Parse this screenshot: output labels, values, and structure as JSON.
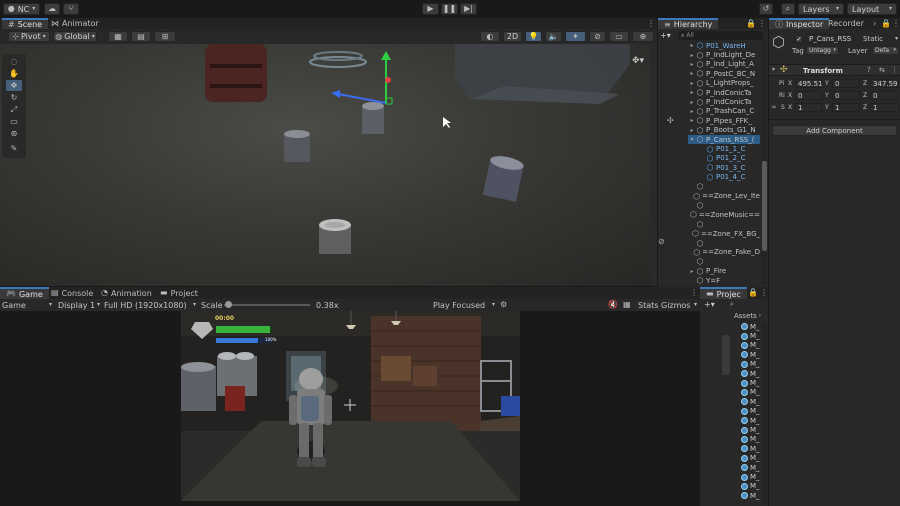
{
  "topbar": {
    "account": "NC",
    "play_icon": "play-icon",
    "pause_icon": "pause-icon",
    "step_icon": "step-icon",
    "layers": "Layers",
    "layout": "Layout"
  },
  "scene": {
    "tabs": [
      {
        "label": "Scene"
      },
      {
        "label": "Animator"
      }
    ],
    "pivot": "Pivot",
    "global": "Global",
    "mode_2d": "2D"
  },
  "game": {
    "tabs": [
      {
        "label": "Game"
      },
      {
        "label": "Console"
      },
      {
        "label": "Animation"
      },
      {
        "label": "Project"
      }
    ],
    "display_type": "Game",
    "display": "Display 1",
    "resolution": "Full HD (1920x1080)",
    "scale_label": "Scale",
    "scale_value": "0.38x",
    "scale_level": 0.02,
    "play_mode": "Play Focused",
    "stats": "Stats",
    "gizmos": "Gizmos",
    "hud_timer": "00:00",
    "hud_pct": "100%"
  },
  "hierarchy": {
    "title": "Hierarchy",
    "search": "All",
    "items": [
      {
        "label": "P01_WareH",
        "blue": true,
        "arrow": "▸"
      },
      {
        "label": "P_IndLight_De",
        "blue": false,
        "arrow": "▸"
      },
      {
        "label": "P_Ind_Light_A",
        "blue": false,
        "arrow": "▸"
      },
      {
        "label": "P_PostC_BC_N",
        "blue": false,
        "arrow": "▸"
      },
      {
        "label": "L_LightProps_",
        "blue": false,
        "arrow": "▸"
      },
      {
        "label": "P_IndConicTa",
        "blue": false,
        "arrow": "▸"
      },
      {
        "label": "P_IndConicTa",
        "blue": false,
        "arrow": "▸"
      },
      {
        "label": "P_TrashCan_C",
        "blue": false,
        "arrow": "▸"
      },
      {
        "label": "P_Pipes_FFK_",
        "blue": false,
        "arrow": "▸"
      },
      {
        "label": "P_Boots_G1_N",
        "blue": false,
        "arrow": "▸"
      },
      {
        "label": "P_Cans_RSS_(",
        "blue": false,
        "arrow": "▾",
        "selected": true
      },
      {
        "label": "P01_1_C",
        "blue": true,
        "arrow": "",
        "indent": true
      },
      {
        "label": "P01_2_C",
        "blue": true,
        "arrow": "",
        "indent": true
      },
      {
        "label": "P01_3_C",
        "blue": true,
        "arrow": "",
        "indent": true
      },
      {
        "label": "P01_4_C",
        "blue": true,
        "arrow": "",
        "indent": true
      },
      {
        "label": "",
        "blue": false,
        "arrow": ""
      },
      {
        "label": "==Zone_Lev_Ite",
        "blue": false,
        "arrow": ""
      },
      {
        "label": "",
        "blue": false,
        "arrow": ""
      },
      {
        "label": "==ZoneMusic==",
        "blue": false,
        "arrow": ""
      },
      {
        "label": "",
        "blue": false,
        "arrow": ""
      },
      {
        "label": "==Zone_FX_BG_",
        "blue": false,
        "arrow": ""
      },
      {
        "label": "",
        "blue": false,
        "arrow": ""
      },
      {
        "label": "==Zone_Fake_D",
        "blue": false,
        "arrow": ""
      },
      {
        "label": "",
        "blue": false,
        "arrow": ""
      },
      {
        "label": "P_Fire",
        "blue": false,
        "arrow": "▸"
      },
      {
        "label": "Y=F",
        "blue": false,
        "arrow": ""
      }
    ]
  },
  "project": {
    "title": "Projec",
    "assets_label": "Assets",
    "items": [
      "M_",
      "M_",
      "M_",
      "M_",
      "M_",
      "M_",
      "M_",
      "M_",
      "M_",
      "M_",
      "M_",
      "M_",
      "M_",
      "M_",
      "M_",
      "M_",
      "M_",
      "M_",
      "M_"
    ]
  },
  "inspector": {
    "tabs": [
      {
        "label": "Inspector"
      },
      {
        "label": "Recorder"
      }
    ],
    "object_name": "P_Cans_RSS",
    "static": "Static",
    "tag_label": "Tag",
    "tag_value": "Untagg",
    "layer_label": "Layer",
    "layer_value": "Defa",
    "component": "Transform",
    "pos_label": "Pi",
    "rot_label": "Ri",
    "scale_label": "S",
    "pos": {
      "x": "495.51",
      "y": "0",
      "z": "347.59"
    },
    "rot": {
      "x": "0",
      "y": "0",
      "z": "0"
    },
    "scale": {
      "x": "1",
      "y": "1",
      "z": "1"
    },
    "axis": {
      "x": "X",
      "y": "Y",
      "z": "Z"
    },
    "add_component": "Add Component"
  },
  "colors": {
    "accent": "#3a79bb",
    "selection": "#2c5d87",
    "gizmo_y": "#2ecc40",
    "gizmo_x": "#e04040",
    "gizmo_z": "#3a6df0"
  }
}
